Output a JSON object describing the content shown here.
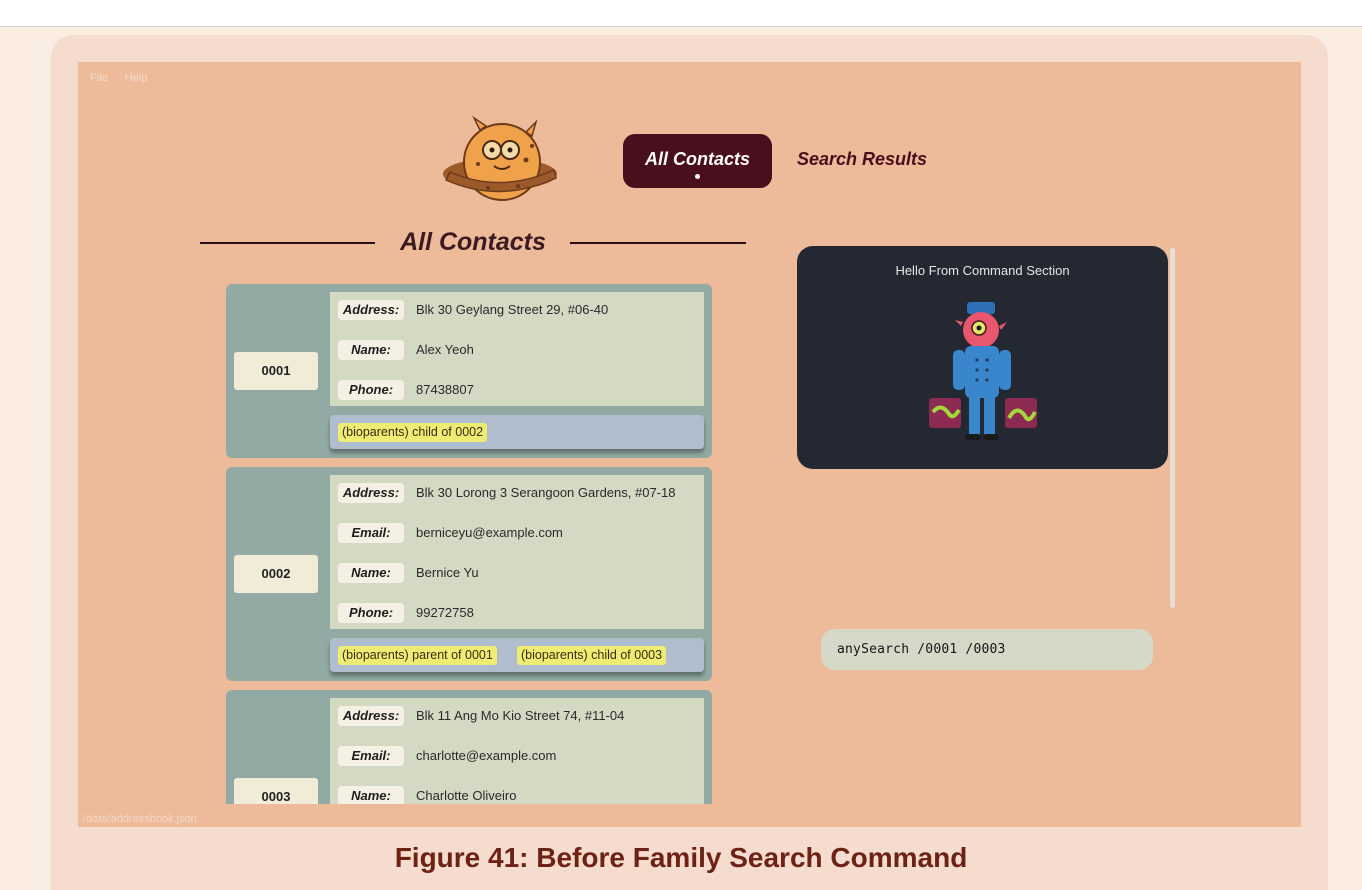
{
  "menu": {
    "file": "File",
    "help": "Help"
  },
  "tabs": {
    "all_contacts": "All Contacts",
    "search_results": "Search Results"
  },
  "section": {
    "title": "All Contacts"
  },
  "contacts": [
    {
      "id": "0001",
      "fields": [
        {
          "label": "Address:",
          "value": "Blk 30 Geylang Street 29, #06-40"
        },
        {
          "label": "Name:",
          "value": "Alex Yeoh"
        },
        {
          "label": "Phone:",
          "value": "87438807"
        }
      ],
      "tags": [
        "(bioparents) child of 0002"
      ]
    },
    {
      "id": "0002",
      "fields": [
        {
          "label": "Address:",
          "value": "Blk 30 Lorong 3 Serangoon Gardens, #07-18"
        },
        {
          "label": "Email:",
          "value": "berniceyu@example.com"
        },
        {
          "label": "Name:",
          "value": "Bernice Yu"
        },
        {
          "label": "Phone:",
          "value": "99272758"
        }
      ],
      "tags": [
        "(bioparents) parent of 0001",
        "(bioparents) child of 0003"
      ]
    },
    {
      "id": "0003",
      "fields": [
        {
          "label": "Address:",
          "value": "Blk 11 Ang Mo Kio Street 74, #11-04"
        },
        {
          "label": "Email:",
          "value": "charlotte@example.com"
        },
        {
          "label": "Name:",
          "value": "Charlotte Oliveiro"
        }
      ],
      "tags": []
    }
  ],
  "command": {
    "hello": "Hello From Command Section",
    "input_value": "anySearch /0001 /0003"
  },
  "status": {
    "path": "./data/addressbook.json"
  },
  "caption": "Figure 41: Before Family Search Command"
}
